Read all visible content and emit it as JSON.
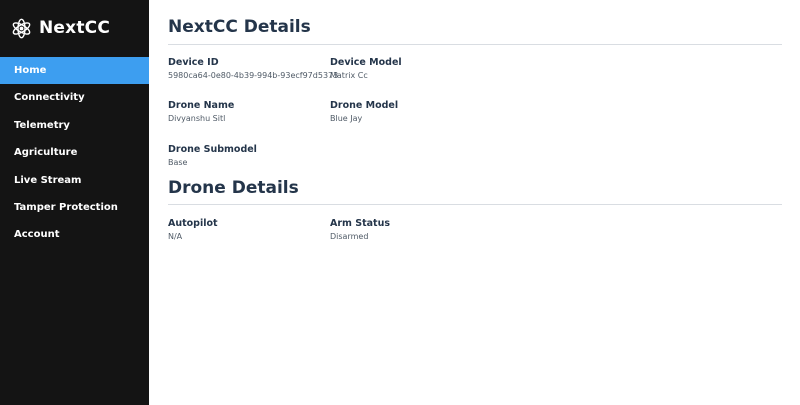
{
  "brand": {
    "title": "NextCC",
    "icon": "drone-icon"
  },
  "sidebar": {
    "items": [
      {
        "label": "Home",
        "active": true
      },
      {
        "label": "Connectivity",
        "active": false
      },
      {
        "label": "Telemetry",
        "active": false
      },
      {
        "label": "Agriculture",
        "active": false
      },
      {
        "label": "Live Stream",
        "active": false
      },
      {
        "label": "Tamper Protection",
        "active": false
      },
      {
        "label": "Account",
        "active": false
      }
    ]
  },
  "nextcc_details": {
    "title": "NextCC Details",
    "device_id": {
      "label": "Device ID",
      "value": "5980ca64-0e80-4b39-994b-93ecf97d5373"
    },
    "device_model": {
      "label": "Device Model",
      "value": "Matrix Cc"
    },
    "drone_name": {
      "label": "Drone Name",
      "value": "Divyanshu Sitl"
    },
    "drone_model": {
      "label": "Drone Model",
      "value": "Blue Jay"
    },
    "drone_submodel": {
      "label": "Drone Submodel",
      "value": "Base"
    }
  },
  "drone_details": {
    "title": "Drone Details",
    "autopilot": {
      "label": "Autopilot",
      "value": "N/A"
    },
    "arm_status": {
      "label": "Arm Status",
      "value": "Disarmed"
    }
  },
  "colors": {
    "sidebar_bg": "#141414",
    "active_item": "#3d9ef0",
    "heading": "#24354a"
  }
}
